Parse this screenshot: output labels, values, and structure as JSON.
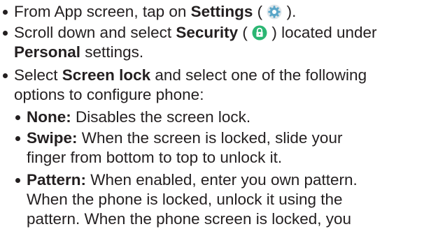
{
  "instructions": {
    "step1": {
      "prefix": "From App screen, tap on ",
      "bold": "Settings",
      "open": " ( ",
      "icon": "settings-gear-icon",
      "close": " )."
    },
    "step2": {
      "prefix": "Scroll down and select ",
      "bold": "Security",
      "open": " ( ",
      "icon": "lock-icon",
      "close": " ) located under",
      "line2_bold": "Personal",
      "line2_suffix": " settings."
    },
    "step3": {
      "prefix": "Select ",
      "bold": "Screen lock",
      "suffix": " and select one of the following",
      "line2": "options to configure phone:"
    },
    "options": [
      {
        "title": "None:",
        "lines": [
          " Disables the screen lock."
        ]
      },
      {
        "title": "Swipe:",
        "lines": [
          " When the screen is locked, slide your",
          "finger from bottom to top to unlock it."
        ]
      },
      {
        "title": "Pattern:",
        "lines": [
          " When enabled, enter you own pattern.",
          "When the phone is locked, unlock it using the",
          "pattern. When the phone screen is locked, you"
        ]
      }
    ]
  },
  "colors": {
    "text": "#231f20",
    "settings_icon": "#5aa6c8",
    "lock_icon": "#2bb673"
  }
}
